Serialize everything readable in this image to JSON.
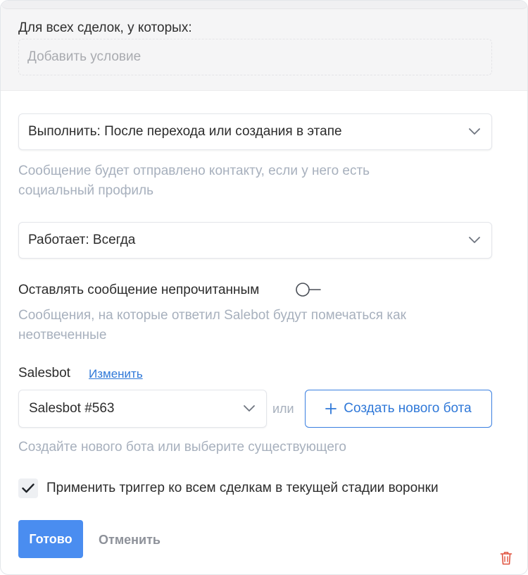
{
  "conditions": {
    "label": "Для всех сделок, у которых:",
    "placeholder": "Добавить условие"
  },
  "execute": {
    "value": "Выполнить: После перехода или создания в этапе",
    "hint_line1": "Сообщение будет отправлено контакту, если у него есть",
    "hint_line2": "социальный профиль"
  },
  "works": {
    "value": "Работает: Всегда"
  },
  "unread": {
    "label": "Оставлять сообщение непрочитанным",
    "enabled": false,
    "hint_line1": "Сообщения, на которые ответил Salebot будут помечаться как",
    "hint_line2": "неотвеченные"
  },
  "salesbot": {
    "label": "Salesbot",
    "change_link": "Изменить",
    "selected": "Salesbot #563",
    "or_text": "или",
    "create_button": "Создать нового бота",
    "hint": "Создайте нового бота или выберите существующего"
  },
  "apply_all": {
    "label": "Применить триггер ко всем сделкам в текущей стадии воронки",
    "checked": true
  },
  "footer": {
    "done": "Готово",
    "cancel": "Отменить"
  },
  "colors": {
    "accent": "#4a8df0",
    "link": "#2f78d8",
    "hint": "#a7b0bd",
    "delete": "#e0533f"
  },
  "icons": [
    "chevron-down-icon",
    "toggle-off-icon",
    "plus-icon",
    "checkmark-icon",
    "trash-icon"
  ]
}
